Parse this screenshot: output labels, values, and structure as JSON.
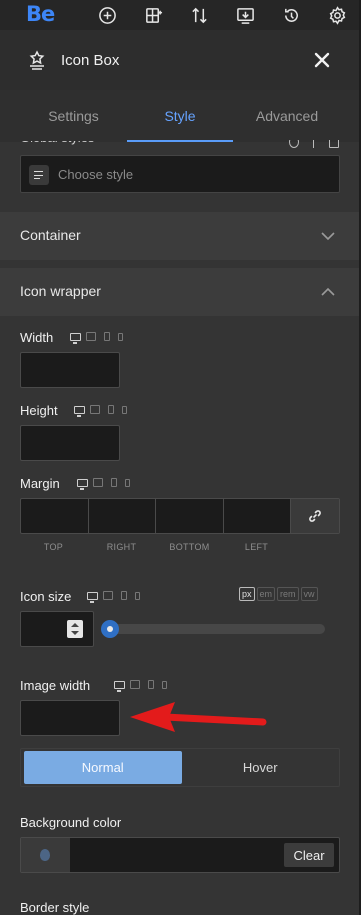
{
  "app": {
    "logo": "Be"
  },
  "toolbar": {
    "icons": [
      "add-element-icon",
      "navigator-icon",
      "sort-icon",
      "templates-icon",
      "history-icon",
      "settings-icon"
    ]
  },
  "panel": {
    "title": "Icon Box",
    "tabs": [
      {
        "label": "Settings",
        "active": false
      },
      {
        "label": "Style",
        "active": true
      },
      {
        "label": "Advanced",
        "active": false
      }
    ]
  },
  "global_styles": {
    "label": "Global styles",
    "placeholder": "Choose style"
  },
  "sections": {
    "container": "Container",
    "icon_wrapper": "Icon wrapper"
  },
  "fields": {
    "width": {
      "label": "Width",
      "value": ""
    },
    "height": {
      "label": "Height",
      "value": ""
    },
    "margin": {
      "label": "Margin",
      "sides": [
        "TOP",
        "RIGHT",
        "BOTTOM",
        "LEFT"
      ]
    },
    "icon_size": {
      "label": "Icon size",
      "units": [
        "px",
        "em",
        "rem",
        "vw"
      ],
      "active_unit": "px",
      "slider_fraction": 0.03
    },
    "image_width": {
      "label": "Image width",
      "value": ""
    }
  },
  "state_toggle": {
    "options": [
      "Normal",
      "Hover"
    ],
    "active": "Normal"
  },
  "background": {
    "label": "Background color",
    "clear_label": "Clear"
  },
  "border_style": {
    "label": "Border style"
  },
  "colors": {
    "accent": "#5a9cf8",
    "toggle_active": "#7aabe3",
    "annotation_arrow": "#e31b1b"
  }
}
